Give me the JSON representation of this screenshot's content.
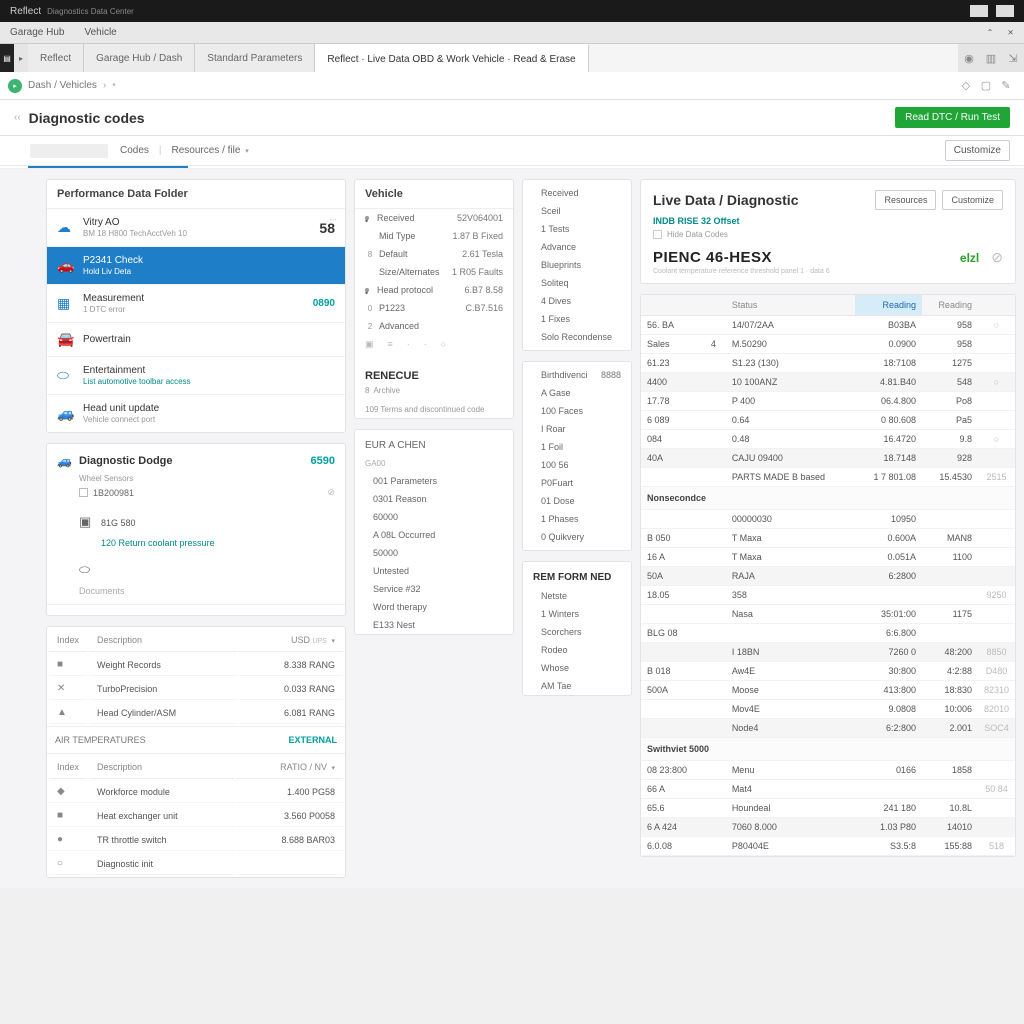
{
  "titlebar": {
    "app": "Reflect",
    "suffix": "Diagnostics Data Center"
  },
  "menubar": {
    "item1": "Garage Hub",
    "item2": "Vehicle"
  },
  "tabs": {
    "t1": "Reflect",
    "t2": "Garage Hub / Dash",
    "t3": "Standard Parameters",
    "t4": "Reflect · Live Data OBD & Work Vehicle · Read & Erase"
  },
  "breadcrumb": {
    "root": "Dash / Vehicles",
    "sep": "›"
  },
  "page": {
    "title": "Diagnostic codes",
    "primary_btn": "Read DTC / Run Test",
    "filter1": "Codes",
    "filter2": "Resources / file",
    "right_btn": "Customize"
  },
  "leftcard": {
    "title": "Performance Data Folder",
    "items": [
      {
        "icon": "cloud",
        "t1": "Vitry AO",
        "t2": "BM 18 H800 TechAcctVeh 10",
        "val": "58",
        "big": true,
        "menu": true
      },
      {
        "icon": "car",
        "t1": "P2341 Check",
        "t2": "Hold Liv Deta",
        "sel": true
      },
      {
        "icon": "ecu",
        "t1": "Measurement",
        "t2": "1 DTC error",
        "val": "0890",
        "teal": true
      },
      {
        "icon": "car2",
        "t1": "Powertrain",
        "t2": ""
      },
      {
        "icon": "oval",
        "t1": "Entertainment",
        "t2": "List automotive toolbar access",
        "tealsub": true
      },
      {
        "icon": "suv",
        "t1": "Head unit update",
        "t2": "Vehicle connect port"
      }
    ]
  },
  "diag": {
    "icon_title": "Diagnostic Dodge",
    "num": "6590",
    "sub": "Wheel Sensors",
    "chk": "1B200981",
    "line_a": "81G 580",
    "line_b": "120 Return coolant pressure",
    "foot": "Documents"
  },
  "lefttable": {
    "h1": "Index",
    "h2": "Description",
    "h3": "USD",
    "h3b": "UPS",
    "rows": [
      {
        "ico": "■",
        "a": "Weight Records",
        "b": "8.338 RANG"
      },
      {
        "ico": "✕",
        "a": "TurboPrecision",
        "b": "0.033 RANG"
      },
      {
        "ico": "▲",
        "a": "Head Cylinder/ASM",
        "b": "6.081 RANG"
      }
    ],
    "sect2_head": "AIR TEMPERATURES",
    "sect2_val": "EXTERNAL",
    "h4": "Index",
    "h5": "Description",
    "h6": "RATIO / NV",
    "rows2": [
      {
        "ico": "◆",
        "a": "Workforce module",
        "b": "1.400 PG58"
      },
      {
        "ico": "■",
        "a": "Heat exchanger unit",
        "b": "3.560 P0058"
      },
      {
        "ico": "●",
        "a": "TR throttle switch",
        "b": "8.688 BAR03"
      },
      {
        "ico": "○",
        "a": "Diagnostic init",
        "b": ""
      }
    ]
  },
  "mid": {
    "title": "Vehicle",
    "rows1": [
      {
        "d": "•",
        "l": "Received",
        "v": "52V064001"
      },
      {
        "d": "",
        "l": "Mid Type",
        "v": "1.87 B Fixed"
      },
      {
        "d": "8",
        "l": "Default",
        "v": "2.61 Tesla"
      },
      {
        "d": "",
        "l": "Size/Alternates",
        "v": "1 R05 Faults"
      },
      {
        "d": "•",
        "l": "Head protocol",
        "v": "6.B7 8.58"
      },
      {
        "d": "0",
        "l": "P1223",
        "v": "C.B7.516"
      },
      {
        "d": "2",
        "l": "Advanced",
        "v": ""
      }
    ],
    "iconrow": [
      "▣",
      "≡",
      "·",
      "·",
      "○"
    ],
    "sect2": "RENECUE",
    "sect2_sub": "8",
    "sect2_sub2": "Archive",
    "sect2_line": "109 Terms and discontinued code",
    "block2": [
      {
        "l": "Received",
        "v": ""
      },
      {
        "l": "Sceil",
        "v": ""
      },
      {
        "l": "1 Tests",
        "v": ""
      },
      {
        "l": "Advance",
        "v": ""
      },
      {
        "l": "Blueprints",
        "v": ""
      },
      {
        "l": "Soliteq",
        "v": ""
      },
      {
        "l": "4 Dives",
        "v": ""
      },
      {
        "l": "1 Fixes",
        "v": ""
      },
      {
        "l": "Solo Recondense",
        "v": ""
      }
    ],
    "sect3": "EUR A CHEN",
    "block3_head": "GA00",
    "block3": [
      {
        "l": "001 Parameters",
        "v": ""
      },
      {
        "l": "0301 Reason",
        "v": ""
      },
      {
        "l": "60000",
        "v": ""
      },
      {
        "l": "A 08L Occurred",
        "v": ""
      },
      {
        "l": "50000",
        "v": ""
      },
      {
        "l": "Untested",
        "v": ""
      },
      {
        "l": "Service #32",
        "v": ""
      },
      {
        "l": "Word therapy",
        "v": ""
      },
      {
        "l": "E133 Nest",
        "v": ""
      }
    ],
    "block4": [
      {
        "l": "Birthdivenci",
        "v": "8888"
      },
      {
        "l": "A Gase",
        "v": ""
      },
      {
        "l": "100 Faces",
        "v": ""
      },
      {
        "l": "I Roar",
        "v": ""
      },
      {
        "l": "1 Foil",
        "v": ""
      },
      {
        "l": "100 56",
        "v": ""
      },
      {
        "l": "P0Fuart",
        "v": ""
      },
      {
        "l": "01 Dose",
        "v": ""
      },
      {
        "l": "1 Phases",
        "v": ""
      },
      {
        "l": "0 Quikvery",
        "v": ""
      }
    ],
    "sect5": "REM FORM NED",
    "block5": [
      {
        "l": "Netste",
        "v": ""
      },
      {
        "l": "1 Winters",
        "v": ""
      },
      {
        "l": "Scorchers",
        "v": ""
      },
      {
        "l": "Rodeo",
        "v": ""
      },
      {
        "l": "Whose",
        "v": ""
      },
      {
        "l": "AM Tae",
        "v": ""
      }
    ]
  },
  "right": {
    "title": "Live Data / Diagnostic",
    "btn1": "Resources",
    "btn2": "Customize",
    "sub1": "INDB RISE 32 Offset",
    "chk": "Hide Data Codes",
    "code": "PIENC 46-HESX",
    "ok": "elzl",
    "desc": "Coolant temperature reference threshold panel 1 · data 6"
  },
  "rtable": {
    "heads": [
      "",
      "",
      "Status",
      "Reading",
      "Reading",
      ""
    ],
    "rows": [
      [
        "56. BA",
        "",
        "14/07/2AA",
        "B03BA",
        "958",
        "○"
      ],
      [
        "Sales",
        "4",
        "M.50290",
        "0.0900",
        "958",
        ""
      ],
      [
        "61.23",
        "",
        "S1.23 (130)",
        "18:7108",
        "1275",
        ""
      ],
      [
        "4400",
        "",
        "10 100ANZ",
        "4.81.B40",
        "548",
        "○"
      ],
      [
        "17.78",
        "",
        "P 400",
        "06.4.800",
        "Po8",
        ""
      ],
      [
        "6 089",
        "",
        "0.64",
        "0 80.608",
        "Pa5",
        ""
      ],
      [
        "084",
        "",
        "0.48",
        "16.4720",
        "9.8",
        "○"
      ],
      [
        "40A",
        "",
        "CAJU 09400",
        "18.7148",
        "928",
        ""
      ],
      [
        "",
        "",
        "PARTS MADE B based",
        "1 7 801.08",
        "15.4530",
        "2515"
      ]
    ],
    "sect2_head": "Nonsecondce",
    "rows2": [
      [
        "",
        "",
        "00000030",
        "10950",
        "",
        ""
      ],
      [
        "B 050",
        "",
        "T Maxa",
        "0.600A",
        "MAN8",
        ""
      ],
      [
        "16 A",
        "",
        "T Maxa",
        "0.051A",
        "1100",
        ""
      ],
      [
        "50A",
        "",
        "RAJA",
        "6:2800",
        "",
        ""
      ],
      [
        "18.05",
        "",
        "358",
        "",
        "",
        "9250"
      ],
      [
        "",
        "",
        "Nasa",
        "35:01:00",
        "1175",
        ""
      ],
      [
        "BLG 08",
        "",
        "",
        "6:6.800",
        "",
        ""
      ],
      [
        "",
        "",
        "I 18BN",
        "7260 0",
        "48:200",
        "8850"
      ],
      [
        "B 018",
        "",
        "Aw4E",
        "30:800",
        "4:2:88",
        "D480"
      ],
      [
        "500A",
        "",
        "Moose",
        "413:800",
        "18:830",
        "82310"
      ],
      [
        "",
        "",
        "Mov4E",
        "9.0808",
        "10:006",
        "82010"
      ],
      [
        "",
        "",
        "Node4",
        "6:2:800",
        "2.001",
        "SOC4"
      ]
    ],
    "sect3_head": "Swithviet 5000",
    "rows3": [
      [
        "08 23:800",
        "",
        "Menu",
        "0166",
        "1858",
        ""
      ],
      [
        "66 A",
        "",
        "Mat4",
        "",
        "",
        "50 84"
      ],
      [
        "65.6",
        "",
        "Houndeal",
        "241 180",
        "10.8L",
        ""
      ],
      [
        "6 A 424",
        "",
        "7060 8.000",
        "1.03 P80",
        "14010",
        ""
      ],
      [
        "6.0.08",
        "",
        "P80404E",
        "S3.5:8",
        "155:88",
        "518"
      ]
    ]
  }
}
